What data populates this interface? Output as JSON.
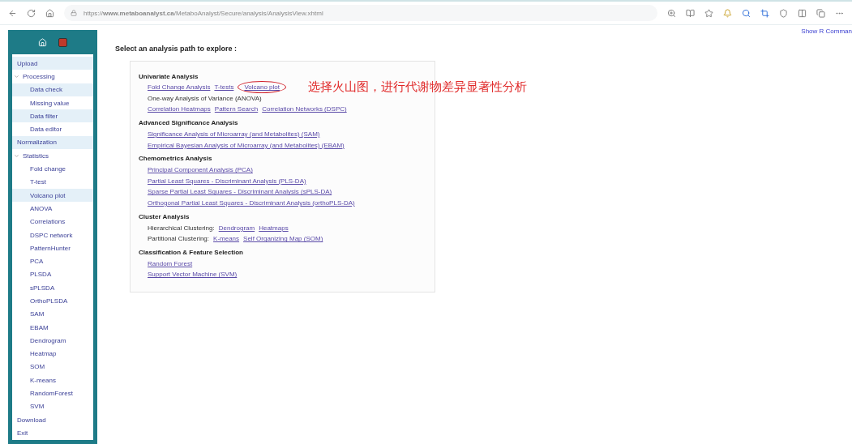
{
  "browser": {
    "url": "https://**www.metaboanalyst.ca**/MetaboAnalyst/Secure/analysis/AnalysisView.xhtml"
  },
  "top_link": "Show R Comman",
  "sidebar": {
    "items": [
      {
        "label": "Upload",
        "highlighted": true
      },
      {
        "label": "Processing",
        "highlighted": false,
        "expanded": true,
        "children": [
          {
            "label": "Data check",
            "highlighted": true
          },
          {
            "label": "Missing value",
            "highlighted": false
          },
          {
            "label": "Data filter",
            "highlighted": true
          },
          {
            "label": "Data editor",
            "highlighted": false
          }
        ]
      },
      {
        "label": "Normalization",
        "highlighted": true
      },
      {
        "label": "Statistics",
        "highlighted": false,
        "expanded": true,
        "children": [
          {
            "label": "Fold change",
            "highlighted": false
          },
          {
            "label": "T-test",
            "highlighted": false
          },
          {
            "label": "Volcano plot",
            "highlighted": true
          },
          {
            "label": "ANOVA",
            "highlighted": false
          },
          {
            "label": "Correlations",
            "highlighted": false
          },
          {
            "label": "DSPC network",
            "highlighted": false
          },
          {
            "label": "PatternHunter",
            "highlighted": false
          },
          {
            "label": "PCA",
            "highlighted": false
          },
          {
            "label": "PLSDA",
            "highlighted": false
          },
          {
            "label": "sPLSDA",
            "highlighted": false
          },
          {
            "label": "OrthoPLSDA",
            "highlighted": false
          },
          {
            "label": "SAM",
            "highlighted": false
          },
          {
            "label": "EBAM",
            "highlighted": false
          },
          {
            "label": "Dendrogram",
            "highlighted": false
          },
          {
            "label": "Heatmap",
            "highlighted": false
          },
          {
            "label": "SOM",
            "highlighted": false
          },
          {
            "label": "K-means",
            "highlighted": false
          },
          {
            "label": "RandomForest",
            "highlighted": false
          },
          {
            "label": "SVM",
            "highlighted": false
          }
        ]
      },
      {
        "label": "Download",
        "highlighted": false
      },
      {
        "label": "Exit",
        "highlighted": false
      }
    ]
  },
  "heading": "Select an analysis path to explore :",
  "sections": [
    {
      "title": "Univariate Analysis",
      "rows": [
        {
          "parts": [
            {
              "kind": "link",
              "text": "Fold Change Analysis"
            },
            {
              "kind": "link",
              "text": "T-tests"
            },
            {
              "kind": "link",
              "text": "Volcano plot",
              "circled": true
            }
          ],
          "annotation": "选择火山图，进行代谢物差异显著性分析"
        },
        {
          "parts": [
            {
              "kind": "text",
              "text": "One-way Analysis of Variance (ANOVA)"
            }
          ]
        },
        {
          "parts": [
            {
              "kind": "link",
              "text": "Correlation Heatmaps"
            },
            {
              "kind": "link",
              "text": "Pattern Search"
            },
            {
              "kind": "link",
              "text": "Correlation Networks (DSPC)"
            }
          ]
        }
      ]
    },
    {
      "title": "Advanced Significance Analysis",
      "rows": [
        {
          "parts": [
            {
              "kind": "link",
              "text": "Significance Analysis of Microarray (and Metabolites) (SAM)"
            }
          ]
        },
        {
          "parts": [
            {
              "kind": "link",
              "text": "Empirical Bayesian Analysis of Microarray (and Metabolites) (EBAM)"
            }
          ]
        }
      ]
    },
    {
      "title": "Chemometrics Analysis",
      "rows": [
        {
          "parts": [
            {
              "kind": "link",
              "text": "Principal Component Analysis (PCA)"
            }
          ]
        },
        {
          "parts": [
            {
              "kind": "link",
              "text": "Partial Least Squares - Discriminant Analysis (PLS-DA)"
            }
          ]
        },
        {
          "parts": [
            {
              "kind": "link",
              "text": "Sparse Partial Least Squares - Discriminant Analysis (sPLS-DA)"
            }
          ]
        },
        {
          "parts": [
            {
              "kind": "link",
              "text": "Orthogonal Partial Least Squares - Discriminant Analysis (orthoPLS-DA)"
            }
          ]
        }
      ]
    },
    {
      "title": "Cluster Analysis",
      "rows": [
        {
          "parts": [
            {
              "kind": "text",
              "text": "Hierarchical Clustering:"
            },
            {
              "kind": "link",
              "text": "Dendrogram"
            },
            {
              "kind": "link",
              "text": "Heatmaps"
            }
          ]
        },
        {
          "parts": [
            {
              "kind": "text",
              "text": "Partitional Clustering:"
            },
            {
              "kind": "link",
              "text": "K-means"
            },
            {
              "kind": "link",
              "text": "Self Organizing Map (SOM)"
            }
          ]
        }
      ]
    },
    {
      "title": "Classification & Feature Selection",
      "rows": [
        {
          "parts": [
            {
              "kind": "link",
              "text": "Random Forest"
            }
          ]
        },
        {
          "parts": [
            {
              "kind": "link",
              "text": "Support Vector Machine (SVM)"
            }
          ]
        }
      ]
    }
  ]
}
